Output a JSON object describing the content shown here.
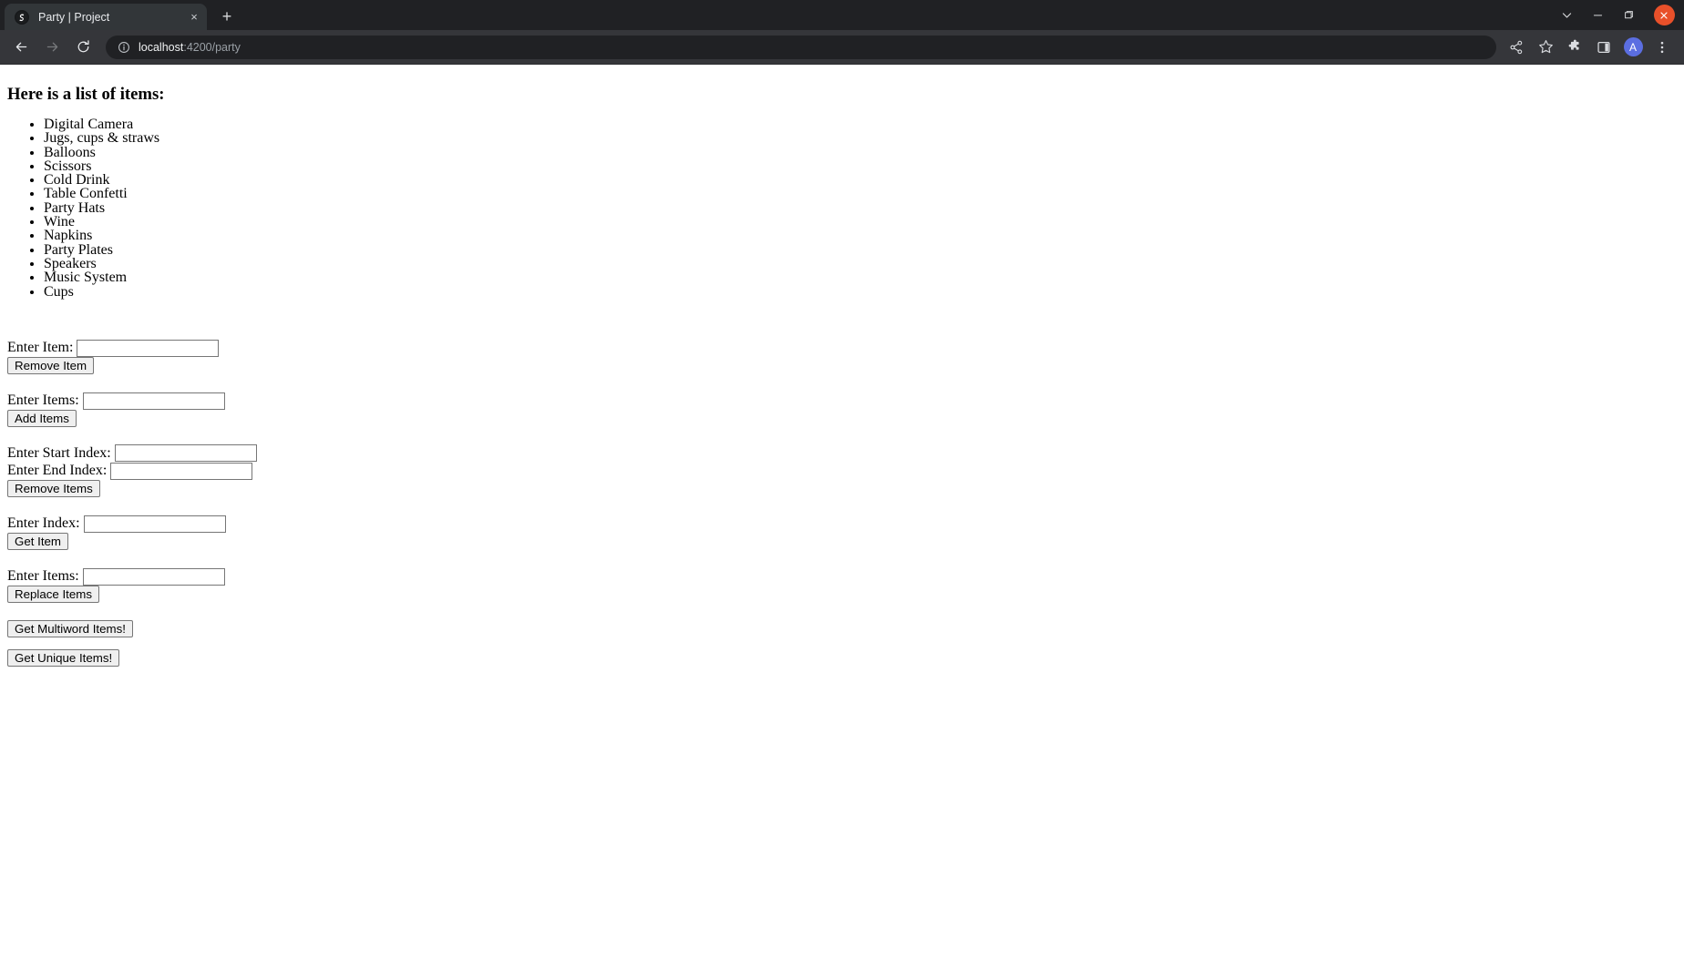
{
  "browser": {
    "tab": {
      "title": "Party | Project",
      "favicon_glyph": "S",
      "close_glyph": "×"
    },
    "new_tab_glyph": "+",
    "window_controls": {
      "tab_search": "tab-search-chevron",
      "minimize": "minimize",
      "maximize": "maximize",
      "close": "close"
    },
    "toolbar": {
      "back": "back",
      "forward": "forward",
      "reload": "reload",
      "url_host": "localhost",
      "url_rest": ":4200/party",
      "site_info": "info-icon",
      "share": "share-icon",
      "bookmark": "star-icon",
      "extensions": "puzzle-icon",
      "side_panel": "side-panel-icon",
      "profile_initial": "A",
      "menu": "three-dot-menu"
    }
  },
  "page": {
    "heading": "Here is a list of items:",
    "items": [
      "Digital Camera",
      "Jugs, cups & straws",
      "Balloons",
      "Scissors",
      "Cold Drink",
      "Table Confetti",
      "Party Hats",
      "Wine",
      "Napkins",
      "Party Plates",
      "Speakers",
      "Music System",
      "Cups"
    ],
    "forms": {
      "remove_item": {
        "label": "Enter Item:",
        "value": "",
        "placeholder": "",
        "button": "Remove Item"
      },
      "add_items": {
        "label": "Enter Items:",
        "value": "",
        "placeholder": "",
        "button": "Add Items"
      },
      "remove_items_range": {
        "start_label": "Enter Start Index:",
        "start_value": "",
        "end_label": "Enter End Index:",
        "end_value": "",
        "button": "Remove Items"
      },
      "get_item": {
        "label": "Enter Index:",
        "value": "",
        "placeholder": "",
        "button": "Get Item"
      },
      "replace_items": {
        "label": "Enter Items:",
        "value": "",
        "placeholder": "",
        "button": "Replace Items"
      },
      "multiword_button": "Get Multiword Items!",
      "unique_button": "Get Unique Items!"
    }
  },
  "colors": {
    "tabstrip_bg": "#202124",
    "active_tab_bg": "#323639",
    "toolbar_bg": "#35363a",
    "omnibox_bg": "#202124",
    "close_button": "#e8502a",
    "avatar": "#5b6ee1",
    "page_bg": "#ffffff"
  }
}
